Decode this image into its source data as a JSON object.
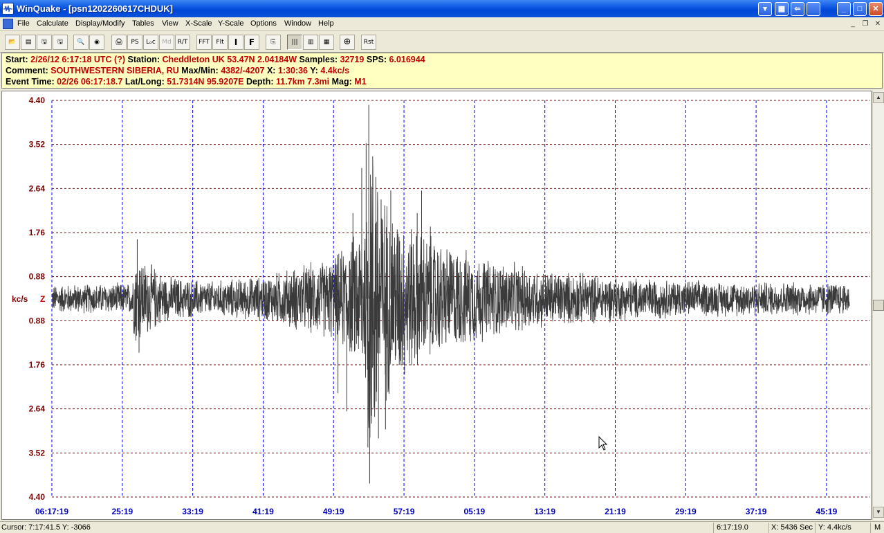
{
  "window": {
    "title": "WinQuake - [psn1202260617CHDUK]",
    "app_icon": "seismograph-icon",
    "controls": {
      "minimize": "_",
      "maximize": "□",
      "close": "✕"
    }
  },
  "menu": {
    "items": [
      "File",
      "Calculate",
      "Display/Modify",
      "Tables",
      "View",
      "X-Scale",
      "Y-Scale",
      "Options",
      "Window",
      "Help"
    ],
    "mdi_controls": {
      "minimize": "_",
      "restore": "❐",
      "close": "✕"
    }
  },
  "toolbar": {
    "buttons": [
      {
        "name": "open-icon",
        "label": "📂"
      },
      {
        "name": "list-icon",
        "label": "▤"
      },
      {
        "name": "save-all-icon",
        "label": "🖫"
      },
      {
        "name": "save-icon",
        "label": "🖫"
      },
      {
        "name": "preview-icon",
        "label": "🔍"
      },
      {
        "name": "record-icon",
        "label": "◉"
      },
      {
        "name": "print-icon",
        "label": "🖨"
      },
      {
        "name": "ps-icon",
        "label": "PS"
      },
      {
        "name": "locate-icon",
        "label": "Lₒc"
      },
      {
        "name": "magnitude-icon",
        "label": "Md"
      },
      {
        "name": "ratio-icon",
        "label": "R/T"
      },
      {
        "name": "fft-icon",
        "label": "FFT"
      },
      {
        "name": "filter-icon",
        "label": "Flt"
      },
      {
        "name": "integrate-icon",
        "label": "I"
      },
      {
        "name": "filter-f-icon",
        "label": "F"
      },
      {
        "name": "copy-icon",
        "label": "⎘"
      },
      {
        "name": "grid-icon",
        "label": "|||"
      },
      {
        "name": "grid-alt-icon",
        "label": "▥"
      },
      {
        "name": "spectrum-icon",
        "label": "▦"
      },
      {
        "name": "target-icon",
        "label": "⊕"
      },
      {
        "name": "reset-icon",
        "label": "Rst"
      }
    ]
  },
  "info": {
    "line1": {
      "start_label": "Start:",
      "start_value": "2/26/12  6:17:18 UTC (?)",
      "station_label": "Station:",
      "station_value": "Cheddleton UK 53.47N 2.04184W",
      "samples_label": "Samples:",
      "samples_value": "32719",
      "sps_label": "SPS:",
      "sps_value": "6.016944"
    },
    "line2": {
      "comment_label": "Comment:",
      "comment_value": "SOUTHWESTERN SIBERIA, RU",
      "maxmin_label": "Max/Min:",
      "maxmin_value": "4382/-4207",
      "x_label": "X:",
      "x_value": "1:30:36",
      "y_label": "Y:",
      "y_value": "4.4kc/s"
    },
    "line3": {
      "event_label": "Event Time:",
      "event_value": "02/26 06:17:18.7",
      "latlong_label": "Lat/Long:",
      "latlong_value": "51.7314N 95.9207E",
      "depth_label": "Depth:",
      "depth_value": "11.7km 7.3mi",
      "mag_label": "Mag:",
      "mag_value": "M1"
    }
  },
  "chart_data": {
    "type": "line",
    "unit_label": "kc/s",
    "component": "Z",
    "y_tick_labels": [
      "4.40",
      "3.52",
      "2.64",
      "1.76",
      "0.88",
      "0.88",
      "1.76",
      "2.64",
      "3.52",
      "4.40"
    ],
    "x_tick_labels": [
      "06:17:19",
      "25:19",
      "33:19",
      "41:19",
      "49:19",
      "57:19",
      "05:19",
      "13:19",
      "21:19",
      "29:19",
      "37:19",
      "45:19"
    ],
    "x_range_minutes": [
      0,
      90.6
    ],
    "y_range": [
      -4.4,
      4.4
    ],
    "grid": {
      "major_vertical": "blue-dashed",
      "horizontal": "darkred-dashed"
    },
    "trace_color": "#3a3a3a",
    "waveform_envelope": [
      {
        "t": 0,
        "amp": 0.34
      },
      {
        "t": 9.0,
        "amp": 0.38
      },
      {
        "t": 9.6,
        "amp": 1.3
      },
      {
        "t": 10.4,
        "amp": 0.95
      },
      {
        "t": 11.5,
        "amp": 0.8
      },
      {
        "t": 13,
        "amp": 0.55
      },
      {
        "t": 18,
        "amp": 0.42
      },
      {
        "t": 24,
        "amp": 0.55
      },
      {
        "t": 29,
        "amp": 0.85
      },
      {
        "t": 32,
        "amp": 1.0
      },
      {
        "t": 34,
        "amp": 1.45
      },
      {
        "t": 35.5,
        "amp": 2.0
      },
      {
        "t": 36.2,
        "amp": 4.4
      },
      {
        "t": 37.5,
        "amp": 2.6
      },
      {
        "t": 40,
        "amp": 1.95
      },
      {
        "t": 44,
        "amp": 1.4
      },
      {
        "t": 50,
        "amp": 0.95
      },
      {
        "t": 56,
        "amp": 0.7
      },
      {
        "t": 65,
        "amp": 0.52
      },
      {
        "t": 75,
        "amp": 0.42
      },
      {
        "t": 90.6,
        "amp": 0.4
      }
    ],
    "spikes": [
      {
        "t": 36.0,
        "v": 4.3
      },
      {
        "t": 36.1,
        "v": -4.1
      },
      {
        "t": 35.7,
        "v": 3.45
      },
      {
        "t": 35.9,
        "v": -3.3
      },
      {
        "t": 35.2,
        "v": 2.9
      },
      {
        "t": 36.8,
        "v": 2.7
      },
      {
        "t": 37.1,
        "v": -3.1
      },
      {
        "t": 37.4,
        "v": 2.2
      },
      {
        "t": 37.9,
        "v": -2.9
      },
      {
        "t": 38.5,
        "v": 2.4
      },
      {
        "t": 41.5,
        "v": 1.9
      },
      {
        "t": 42,
        "v": 2.4
      },
      {
        "t": 43,
        "v": 1.6
      },
      {
        "t": 32.5,
        "v": -2.1
      },
      {
        "t": 33.5,
        "v": -2.5
      },
      {
        "t": 34.2,
        "v": 1.9
      },
      {
        "t": 9.7,
        "v": 1.32
      },
      {
        "t": 9.9,
        "v": -1.2
      }
    ]
  },
  "cursor": "arrow-pointer-icon",
  "status": {
    "cursor": "Cursor: 7:17:41.5  Y: -3066",
    "time": "6:17:19.0",
    "x": "X: 5436 Sec",
    "y": "Y: 4.4kc/s",
    "mode": "M"
  }
}
